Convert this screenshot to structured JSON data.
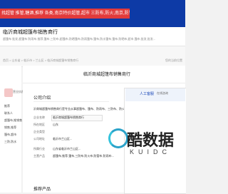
{
  "topbar": {
    "marquee": "找超管 推管,糖酒,推荐 各类,南京特价超管,超市 三防布,防火,南京,防管"
  },
  "header": {
    "title": "临沂商城超篷布销售商行",
    "subtitle": "超篷布 批发,超篷布 防雨布,推荐,篷布,三防布,超篷布,防晒篷布,防雨篷布,篷布,防水篷布,篷布,防晒布,超市,篷布,批发,批发..."
  },
  "breadcrumb": "首页 > 山东省 > 临沂市 > 兰山区 > 临沂商城超篷布销售商行",
  "topright": "您的当前位置",
  "page": {
    "title": "临沂商城超篷布销售商行"
  },
  "sidebar": {
    "badge": "营业执照",
    "items": [
      "推荐",
      "联系人",
      "超篷布,推销售",
      "销售,推荐",
      "篷布,超市",
      "三防,防水"
    ]
  },
  "company": {
    "section_title": "公司介绍",
    "intro": "沂商城超篷布销售商行是专业从事超篷布、篷布、防雨布、三防布、防火布、防晒布等,服务...",
    "rows": [
      {
        "label": "企业名称",
        "value": "临沂商城超篷布销售商行"
      },
      {
        "label": "所在地区",
        "value": "山东"
      },
      {
        "label": "企业类型",
        "value": ""
      },
      {
        "label": "公司地址",
        "value": "临沂市兰山区..."
      },
      {
        "label": "所属行业",
        "value": "山东省临沂市兰山区..."
      },
      {
        "label": "主营产品",
        "value": "超篷布,推荐,篷布,三防布,防火布,防管布,防雨布..."
      }
    ]
  },
  "product": {
    "section_title": "推荐产品"
  },
  "cs": {
    "title": "人工客服",
    "tag": "在线咨询"
  },
  "kuidc": {
    "big": "酷数据",
    "small": "KUIDC"
  },
  "icons": [
    "avatar-icon",
    "kuidc-logo-icon"
  ],
  "colors": {
    "brand": "#0d3aa6",
    "alert": "#e23b3b",
    "link": "#1a48b8",
    "kuidc": "#2aa2c9"
  }
}
